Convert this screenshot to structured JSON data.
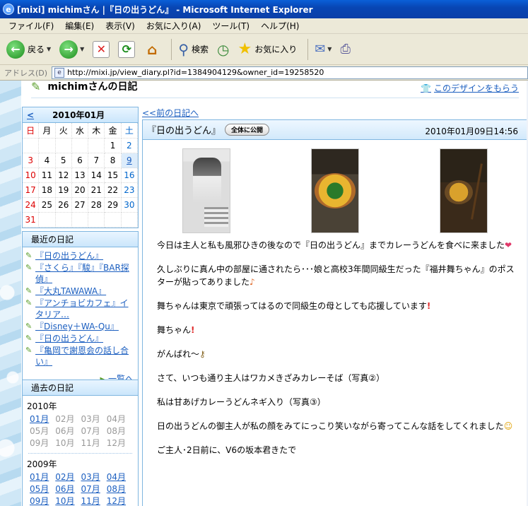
{
  "window": {
    "title": "[mixi] michimさん |『日の出うどん』 - Microsoft Internet Explorer"
  },
  "menu": [
    "ファイル(F)",
    "編集(E)",
    "表示(V)",
    "お気に入り(A)",
    "ツール(T)",
    "ヘルプ(H)"
  ],
  "toolbar": {
    "back_label": "戻る",
    "search_label": "検索",
    "favorites_label": "お気に入り"
  },
  "address": {
    "label": "アドレス(D)",
    "url": "http://mixi.jp/view_diary.pl?id=1384904129&owner_id=19258520"
  },
  "page": {
    "diary_title": "michimさんの日記",
    "design_link": "このデザインをもらう",
    "prev_link": "<<前の日記へ"
  },
  "calendar": {
    "prev": "<",
    "month": "2010年01月",
    "dows": [
      "日",
      "月",
      "火",
      "水",
      "木",
      "金",
      "土"
    ],
    "days": [
      "",
      "",
      "",
      "",
      "",
      "1",
      "2",
      "3",
      "4",
      "5",
      "6",
      "7",
      "8",
      "9",
      "10",
      "11",
      "12",
      "13",
      "14",
      "15",
      "16",
      "17",
      "18",
      "19",
      "20",
      "21",
      "22",
      "23",
      "24",
      "25",
      "26",
      "27",
      "28",
      "29",
      "30",
      "31",
      "",
      "",
      "",
      "",
      "",
      ""
    ],
    "today": "9"
  },
  "recent": {
    "title": "最近の日記",
    "items": [
      "『日の出うどん』",
      "『さくら』『駿』『BAR探偵』",
      "『大丸TAWAWA』",
      "『アンチョビカフェ』イタリア…",
      "『Disney＋WA-Qu』",
      "『日の出うどん』",
      "『亀岡で謝恩会の話し合い』"
    ],
    "more": "一覧へ"
  },
  "past": {
    "title": "過去の日記",
    "years": [
      {
        "year": "2010年",
        "months": [
          {
            "m": "01月",
            "link": true
          },
          {
            "m": "02月",
            "link": false
          },
          {
            "m": "03月",
            "link": false
          },
          {
            "m": "04月",
            "link": false
          },
          {
            "m": "05月",
            "link": false
          },
          {
            "m": "06月",
            "link": false
          },
          {
            "m": "07月",
            "link": false
          },
          {
            "m": "08月",
            "link": false
          },
          {
            "m": "09月",
            "link": false
          },
          {
            "m": "10月",
            "link": false
          },
          {
            "m": "11月",
            "link": false
          },
          {
            "m": "12月",
            "link": false
          }
        ]
      },
      {
        "year": "2009年",
        "months": [
          {
            "m": "01月",
            "link": true
          },
          {
            "m": "02月",
            "link": true
          },
          {
            "m": "03月",
            "link": true
          },
          {
            "m": "04月",
            "link": true
          },
          {
            "m": "05月",
            "link": true
          },
          {
            "m": "06月",
            "link": true
          },
          {
            "m": "07月",
            "link": true
          },
          {
            "m": "08月",
            "link": true
          },
          {
            "m": "09月",
            "link": true
          },
          {
            "m": "10月",
            "link": true
          },
          {
            "m": "11月",
            "link": true
          },
          {
            "m": "12月",
            "link": true
          }
        ]
      }
    ]
  },
  "entry": {
    "title": "『日の出うどん』",
    "badge": "全体に公開",
    "date": "2010年01月09日14:56",
    "paragraphs": [
      {
        "text": "今日は主人と私も風邪ひきの後なので『日の出うどん』までカレーうどんを食べに来ました",
        "emoji": "heart"
      },
      {
        "text": "久しぶりに真ん中の部屋に通されたら･･･娘と高校3年間同級生だった『福井舞ちゃん』のポスターが貼ってありました",
        "emoji": "note"
      },
      {
        "text": "舞ちゃんは東京で頑張ってはるので同級生の母としても応援しています",
        "emoji": "excl"
      },
      {
        "text": "舞ちゃん",
        "emoji": "excl"
      },
      {
        "text": "がんばれ～",
        "emoji": "key"
      },
      {
        "text": "さて、いつも通り主人はワカメきざみカレーそば（写真②）",
        "emoji": ""
      },
      {
        "text": "私は甘あげカレーうどんネギ入り（写真③）",
        "emoji": ""
      },
      {
        "text": "日の出うどんの御主人が私の顔をみてにっこり笑いながら寄ってこんな話をしてくれました",
        "emoji": "smile"
      },
      {
        "text": "ご主人･2日前に、V6の坂本君きたで",
        "emoji": ""
      }
    ]
  }
}
